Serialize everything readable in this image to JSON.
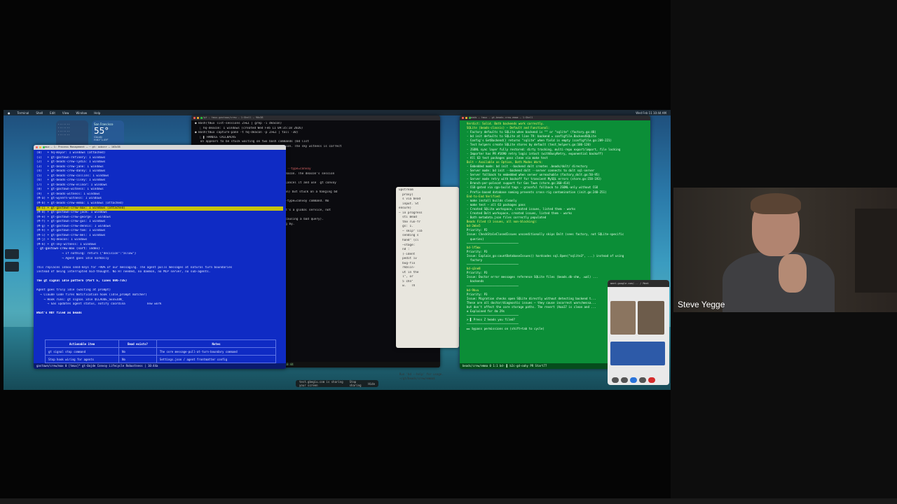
{
  "desktop": {
    "menubar": [
      "Terminal",
      "Shell",
      "Edit",
      "View",
      "Window",
      "Help"
    ],
    "clock": "Wed Feb 11 10:44 AM",
    "weather": {
      "location": "San Francisco",
      "temp": "55°",
      "condition": "Cloudy",
      "range": "H:61° L:49°"
    },
    "dock_items": [
      "test.gbegiu.com is sharing your screen",
      "Stop sharing",
      "Hide"
    ]
  },
  "left_window": {
    "title": "tmux — 1: Process Management — ~ gt: ocbcnr — 103x38",
    "lines": [
      "(0)   + hq-mayor: 1 windows (attached)",
      "(1)   + gt-gastown-refinery: 1 windows",
      "(2)   + gt-beads-crew-lydia: 1 windows",
      "(3)   + gt-beads-crew-jane: 1 windows",
      "(4)   + gt-beads-crew-danny: 1 windows",
      "(5)   + gt-beads-crew-collins: 1 windows",
      "(6)   + gt-beads-crew-lisey: 1 windows",
      "(7)   + gt-beads-crew-elinor: 1 windows",
      "(8)   + gt-gastown-witness: 1 windows",
      "(9)   + gt-beads-witness: 1 windows",
      "(M-a) + gt-wyvern-witness: 1 windows",
      "(M-b) + gt-beads-crew-emma: 1 windows (attached)"
    ],
    "highlight_line": "(M-c) + gt-gastown-crew-max: 1 windows (attached)",
    "lines2": [
      "(M-d) + gt-gastown-crew-jack: 1 windows",
      "(M-e) + gt-gastown-crew-george: 1 windows",
      "(M-f) + gt-gastown-crew-gus: 1 windows",
      "(M-g) + gt-gastown-crew-dennis: 1 windows",
      "(M-h) + gt-gastown-crew-tom: 1 windows",
      "(M-i) + gt-gastown-crew-mel: 1 windows",
      "(M-j) + hq-deacon: 1 windows",
      "(M-k) + gt-sky-witness: 1 windows"
    ],
    "sort_line": "- gt-gastown-crew-max (sort: index) -",
    "preview": [
      "              → If nothing: return {\"decision\":\"allow\"}",
      "              → Agent goes idle normally"
    ],
    "para1": "This replaces inbox send-keys for ~90% of our messaging. The agent pulls messages at natural turn boundaries",
    "para1b": "instead of being interrupted mid-thought. No HT needed, no daemon, no MCP server, no sub-agents.",
    "heading2": "The gt signal idle pattern (Part 5, lines 696-735)",
    "para2": [
      "Agent goes truly idle (waiting at prompt)",
      "  → Claude Code fires Notification hook (idle_prompt matcher)",
      "    → Hook runs: gt signal idle $CLAUDE_SESSION_",
      "      → Gas updates agent status, notify coordina            new work"
    ],
    "table_title": "What's NOT filed as beads",
    "table": {
      "headers": [
        "Actionable item",
        "Bead exists?",
        "Notes"
      ],
      "rows": [
        [
          "gt signal stop command",
          "No",
          "The core message-pull-at-turn-boundary command"
        ],
        [
          "Stop hook wiring for agents",
          "No",
          "Settings.json / agent frontmatter config"
        ]
      ]
    },
    "status": "gastown/crew/max 0 [tmux]*                                  gt-0ajde  Convoy Lifecycle Robustness  | 10:44a"
  },
  "center_window": {
    "title": "~/gt — tmux-gastown/crew — 1:Shell — 90x38",
    "lines": [
      "● Bash(tmux list-sessions 2>&1 | grep -i deacon)",
      "  ⎿ hq-deacon: 1 windows (created Wed Feb 11 09:35:18 2026)",
      "",
      "● Bash(tmux capture-pane -t hq-deacon -p 2>&1 | tail -30)",
      "  ⎿ ▌ HANDLE CALLBACKS",
      "",
      "",
      "",
      "   on appears to be stuck waiting on two bash commands (bd list",
      "   some. This is likely a hang, not a stopped session. The sky witness is correct",
      "   on the issue than \"stopped.\"",
      "",
      "   ping.",
      "",
      "   ion list 2>&1)",
      "",
      "",
      "   ⎿ --type=convoy --status=open 2>&1 | head -10)",
      ""
    ],
    "split_line": {
      "left": "   ie 1: 9189 Run c6d",
      "right": "Command: bd lo list --type=convoy"
    },
    "lines2": [
      "",
      "   (timed out at 10s) That's what's blocking the deacon. The deacon's session",
      "   udge it to unblock.",
      "",
      "   Your bd list --type=convoy command is hanging. Cancel it and use `gt convoy",
      "   out.)",
      "",
      "",
      "   ⎿ --reason=\"Deacon session is running (hq-deacon) but stuck on a hanging bd",
      "      ts.\")",
      "   ng (hq-deacon) but stuck on a hanging bd list --type=convoy command. No",
      "   nt instead.",
      "",
      "",
      "   ons \"Deacon is running in hq-deacon session — it's a global service, not",
      "   bd).",
      "",
      "",
      "   convoy which hangs (likely invalid type filter causing a bad query).",
      "   list instead, and informed sky/witness. Standing by."
    ],
    "status": "1:s   0 3/8 ■  2:1  2 ■ beads  ■ gastown  ■ sky  ■ wyvern   | 10:44"
  },
  "mid_window": {
    "lines": [
      "upstream",
      "",
      "  proxy)",
      "  s via bead",
      "  input. St",
      "",
      "",
      "",
      "",
      "",
      "",
      "ensure)",
      "— in progress",
      "  sti Bead",
      "  the run-fr",
      "  gs: 1.",
      "  — skip\" lib",
      "  sending s",
      "  hand\" (cl",
      "",
      "  —stage:",
      "  nd :",
      "  )-ident",
      "",
      "  pedit iv",
      "  bug-fix",
      "  rkblin-",
      "  ut in the",
      "  l\", or",
      "  5 chn\"",
      "  w.   Th"
    ]
  },
  "right_window": {
    "title": "beads — tmux - gt-beads-crew-emma — 1:Shell",
    "lines": [
      {
        "t": "  Verdict: Solid. Both backends work correctly.",
        "c": "hd"
      },
      {
        "t": "",
        "c": ""
      },
      {
        "t": "  SQLite (beads-classic) — Default and Functional:",
        "c": "hd"
      },
      {
        "t": "  - Factory defaults to SQLite when backend is \"\" or \"sqlite\" (factory.go:48)",
        "c": ""
      },
      {
        "t": "  - bd init defaults to SQLite at line 79: backend = configfile.BackendSQLite",
        "c": ""
      },
      {
        "t": "  - Config's GetBackend() returns \"sqlite\" when field is empty (configfile.go:209-221)",
        "c": ""
      },
      {
        "t": "  - Test helpers create SQLite stores by default (test_helpers.go:106-120)",
        "c": ""
      },
      {
        "t": "  - JSONL sync layer fully restored: dirty tracking, multi-repo export/import, file locking",
        "c": ""
      },
      {
        "t": "  - Importer has PR #1690 retry logic intact (withBusyRetry, exponential backoff)",
        "c": ""
      },
      {
        "t": "  - All 63 test packages pass clean via make test",
        "c": ""
      },
      {
        "t": "",
        "c": ""
      },
      {
        "t": "  Dolt — Available as Option, Both Modes Work:",
        "c": "hd"
      },
      {
        "t": "  - Embedded mode: bd init --backend dolt creates .beads/dolt/ directory",
        "c": ""
      },
      {
        "t": "  - Server mode: bd init --backend dolt --server connects to dolt sql-server",
        "c": ""
      },
      {
        "t": "  - Server fallback to embedded when server unreachable (factory_dolt.go:50-95)",
        "c": ""
      },
      {
        "t": "  - Server mode retry with backoff for transient MySQL errors (store.go:158-193)",
        "c": ""
      },
      {
        "t": "  - Branch-per-polecat support for Gas Town (store.go:360-414)",
        "c": ""
      },
      {
        "t": "  - CGO-gated via cgo-build tags — graceful fallback to JSONL-only without CGO",
        "c": ""
      },
      {
        "t": "  - Prefix-based database naming prevents cross-rig contamination (init.go:240-251)",
        "c": ""
      },
      {
        "t": "",
        "c": ""
      },
      {
        "t": "  End-to-End Verified:",
        "c": "hd"
      },
      {
        "t": "  - make install builds cleanly",
        "c": ""
      },
      {
        "t": "  - make test — all 63 packages pass",
        "c": ""
      },
      {
        "t": "  - Created SQLite workspace, created issues, listed them - works",
        "c": ""
      },
      {
        "t": "  - Created Dolt workspace, created issues, listed them - works",
        "c": ""
      },
      {
        "t": "  - Both metadata.json files correctly populated",
        "c": ""
      },
      {
        "t": "",
        "c": ""
      },
      {
        "t": "  Beads Filed (3 issues, all non-blocking):",
        "c": "hd"
      },
      {
        "t": "  bd-2mbv5",
        "c": "hd"
      },
      {
        "t": "  Priority: P2",
        "c": ""
      },
      {
        "t": "  Issue: CheckStaleClosedIssues unconditionally skips Dolt (sees factory, not SQLite-specific",
        "c": ""
      },
      {
        "t": "    queries)",
        "c": ""
      },
      {
        "t": "  ──────────────────────────────",
        "c": ""
      },
      {
        "t": "  bd-lf5mx",
        "c": "hd"
      },
      {
        "t": "  Priority: P3",
        "c": ""
      },
      {
        "t": "  Issue: Explain_go:countDatabaseIssues() hardcodes sql.Open(\"sqlite3\", ...) instead of using",
        "c": ""
      },
      {
        "t": "    factory",
        "c": ""
      },
      {
        "t": "  ──────────────────────────────",
        "c": ""
      },
      {
        "t": "  bd-q1ne8",
        "c": "hd"
      },
      {
        "t": "  Priority: P3",
        "c": ""
      },
      {
        "t": "  Issue: Doctor error messages reference SQLite files (beads.db-shm, .wal) ...",
        "c": ""
      },
      {
        "t": "    backends",
        "c": ""
      },
      {
        "t": "  ──────────────────────────────",
        "c": ""
      },
      {
        "t": "  bd-9kvu",
        "c": "hd"
      },
      {
        "t": "  Priority: P3",
        "c": ""
      },
      {
        "t": "  Issue: Migration checks open SQLite directly without detecting backend t...",
        "c": ""
      },
      {
        "t": "  These are all doctor/diagnostic issues — they cause incorrect warn/messa...",
        "c": ""
      },
      {
        "t": "  but don't affect the core storage paths. The revert (Aaa17 is clean and ...",
        "c": ""
      },
      {
        "t": "",
        "c": ""
      },
      {
        "t": "  ✻ Explained for 4m 29s",
        "c": ""
      },
      {
        "t": "",
        "c": ""
      },
      {
        "t": "  ──────────────────────────────",
        "c": ""
      },
      {
        "t": "  > ▌ Press Z heads you filed?",
        "c": ""
      },
      {
        "t": "  ──────────────────────────────",
        "c": ""
      },
      {
        "t": "  ►► bypass permissions on (shift+tab to cycle)",
        "c": ""
      }
    ],
    "status": "beads/crew/emma 0 1:1 bd-  ▌ b2c-gd-oahy  PR Start77"
  },
  "below_text": [
    "Run 'bd --help' for usage.",
    "~/gt/beads/crew/emma$"
  ],
  "call": {
    "title": "meet.google.com/... / Meet",
    "participant": "Steve Y."
  },
  "speaker": {
    "name": "Steve Yegge"
  }
}
